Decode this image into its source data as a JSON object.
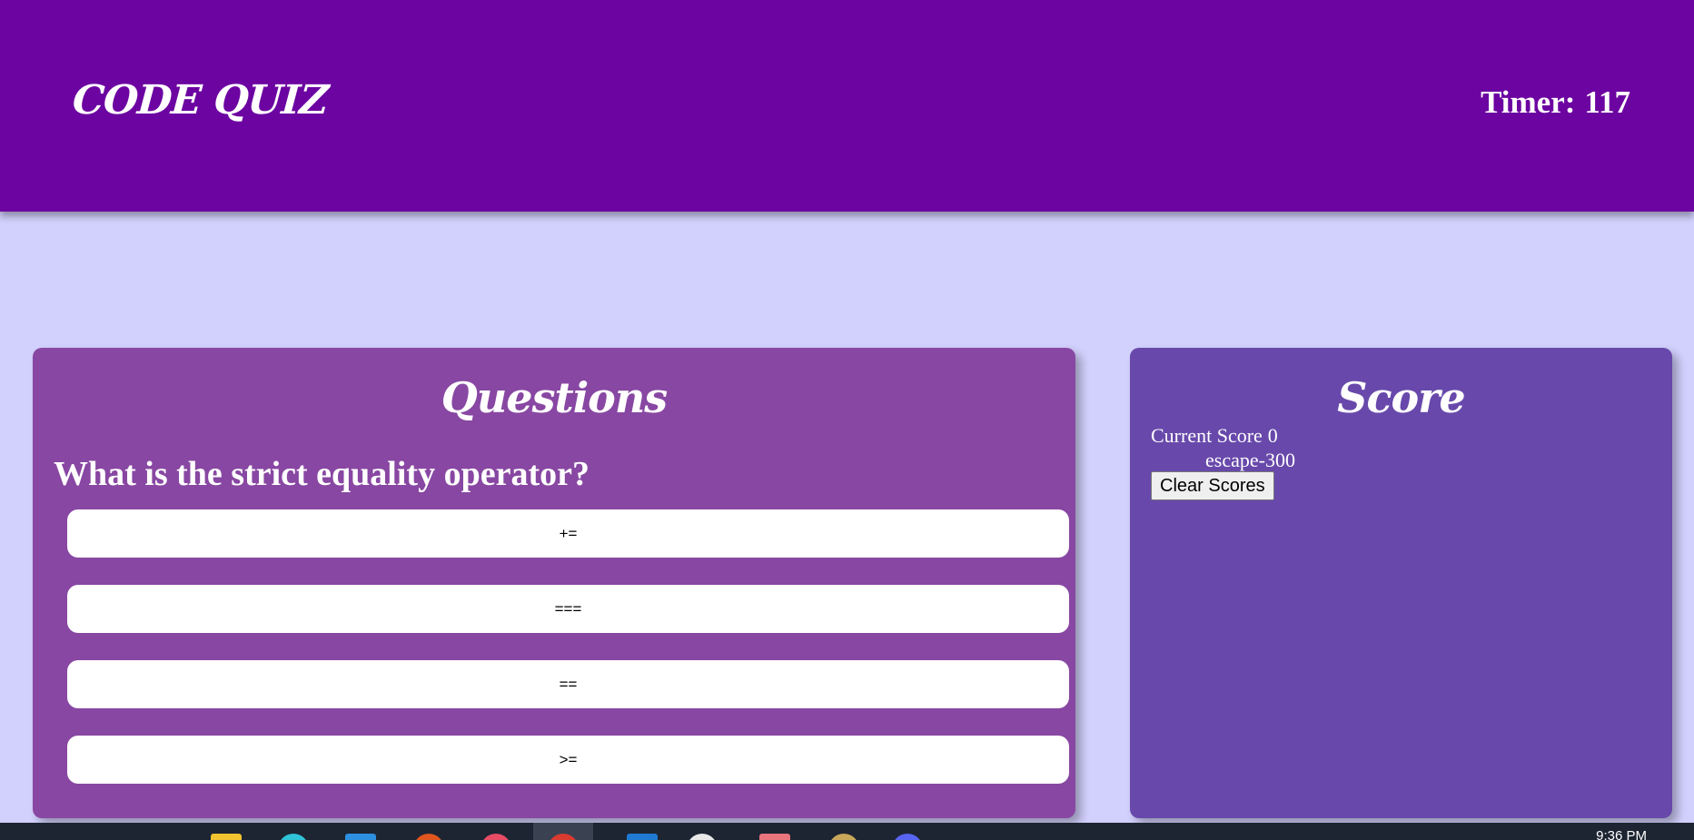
{
  "header": {
    "title": "CODE QUIZ",
    "timer_label": "Timer:",
    "timer_value": "117"
  },
  "questions": {
    "title": "Questions",
    "question": "What is the strict equality operator?",
    "answers": [
      "+=",
      "===",
      "==",
      ">="
    ]
  },
  "score": {
    "title": "Score",
    "current_label": "Current Score",
    "current_value": "0",
    "entries": [
      "escape-300"
    ],
    "clear_label": "Clear Scores"
  },
  "taskbar": {
    "time": "9:36 PM"
  },
  "colors": {
    "header": "#6c04a1",
    "background": "#d2d0fc",
    "questions_panel": "#8847a2",
    "score_panel": "#6849ab"
  }
}
